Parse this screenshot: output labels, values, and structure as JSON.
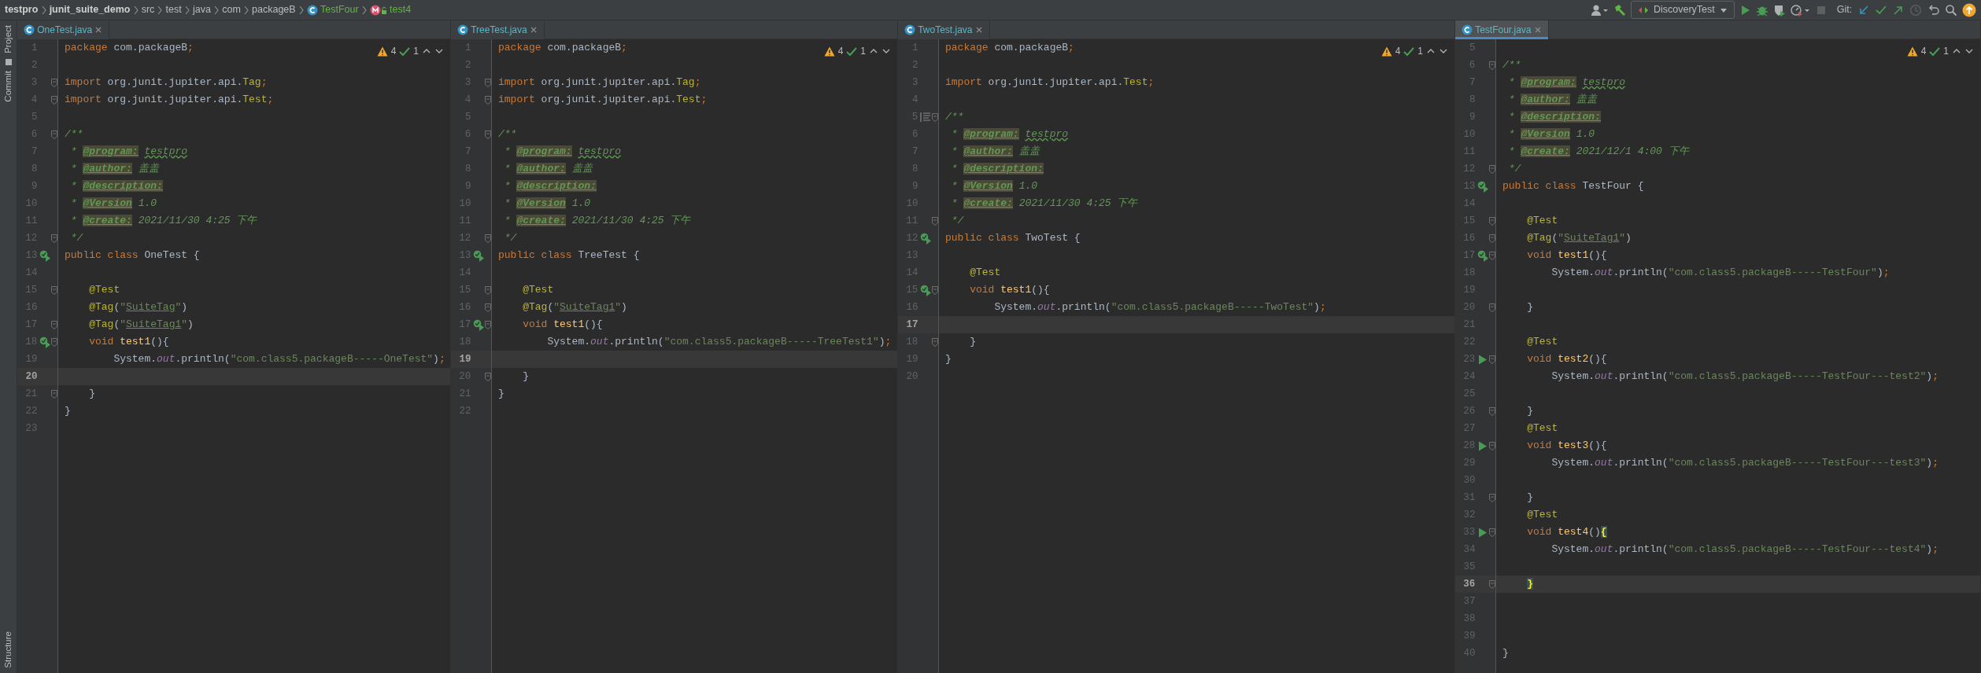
{
  "breadcrumb": [
    {
      "label": "testpro",
      "kind": "module"
    },
    {
      "label": "junit_suite_demo",
      "kind": "module"
    },
    {
      "label": "src",
      "kind": "dir"
    },
    {
      "label": "test",
      "kind": "dir"
    },
    {
      "label": "java",
      "kind": "dir"
    },
    {
      "label": "com",
      "kind": "dir"
    },
    {
      "label": "packageB",
      "kind": "dir"
    },
    {
      "label": "TestFour",
      "kind": "class"
    },
    {
      "label": "test4",
      "kind": "method"
    }
  ],
  "toolbar": {
    "run_config": "DiscoveryTest",
    "git_label": "Git:"
  },
  "tool_windows": [
    {
      "label": "Project"
    },
    {
      "label": "Commit"
    },
    {
      "label": "Structure"
    }
  ],
  "panes": [
    {
      "tab": {
        "label": "OneTest.java",
        "selected": false
      },
      "inspections": {
        "warnings": "4",
        "ok": "1"
      },
      "lines": [
        {
          "n": "1",
          "fold": false,
          "current": false,
          "tokens": [
            {
              "kind": "kw",
              "text": "package "
            },
            {
              "kind": "pl",
              "text": "com.packageB"
            },
            {
              "kind": "kw",
              "text": ";"
            }
          ]
        },
        {
          "n": "2",
          "fold": false,
          "current": false
        },
        {
          "n": "3",
          "fold": true,
          "current": false,
          "tokens": [
            {
              "kind": "kw",
              "text": "import "
            },
            {
              "kind": "pl",
              "text": "org.junit.jupiter.api."
            },
            {
              "kind": "cls",
              "text": "Tag"
            },
            {
              "kind": "kw",
              "text": ";"
            }
          ]
        },
        {
          "n": "4",
          "fold": true,
          "current": false,
          "tokens": [
            {
              "kind": "kw",
              "text": "import "
            },
            {
              "kind": "pl",
              "text": "org.junit.jupiter.api."
            },
            {
              "kind": "cls",
              "text": "Test"
            },
            {
              "kind": "kw",
              "text": ";"
            }
          ]
        },
        {
          "n": "5",
          "fold": false,
          "current": false
        },
        {
          "n": "6",
          "fold": true,
          "current": false,
          "tokens": [
            {
              "kind": "doc",
              "text": "/**"
            }
          ]
        },
        {
          "n": "7",
          "fold": false,
          "current": false,
          "tokens": [
            {
              "kind": "doc",
              "text": " * "
            },
            {
              "kind": "dtag",
              "text": "@program:"
            },
            {
              "kind": "dwave",
              "text": "testpro"
            }
          ]
        },
        {
          "n": "8",
          "fold": false,
          "current": false,
          "tokens": [
            {
              "kind": "doc",
              "text": " * "
            },
            {
              "kind": "dtag",
              "text": "@author:"
            },
            {
              "kind": "doc",
              "text": " 盖盖"
            }
          ]
        },
        {
          "n": "9",
          "fold": false,
          "current": false,
          "tokens": [
            {
              "kind": "doc",
              "text": " * "
            },
            {
              "kind": "dtag",
              "text": "@description:"
            }
          ]
        },
        {
          "n": "10",
          "fold": false,
          "current": false,
          "tokens": [
            {
              "kind": "doc",
              "text": " * "
            },
            {
              "kind": "dtag",
              "text": "@Version"
            },
            {
              "kind": "doc",
              "text": " 1.0"
            }
          ]
        },
        {
          "n": "11",
          "fold": false,
          "current": false,
          "tokens": [
            {
              "kind": "doc",
              "text": " * "
            },
            {
              "kind": "dtag",
              "text": "@create:"
            },
            {
              "kind": "doc",
              "text": " 2021/11/30 4:25 下午"
            }
          ]
        },
        {
          "n": "12",
          "fold": true,
          "current": false,
          "tokens": [
            {
              "kind": "doc",
              "text": " */"
            }
          ]
        },
        {
          "n": "13",
          "kind": "run-check",
          "fold": false,
          "current": false,
          "tokens": [
            {
              "kind": "kw",
              "text": "public class "
            },
            {
              "kind": "pl",
              "text": "OneTest {"
            }
          ]
        },
        {
          "n": "14",
          "fold": false,
          "current": false
        },
        {
          "n": "15",
          "fold": true,
          "current": false,
          "tokens": [
            {
              "kind": "ann",
              "text": "    @Test"
            }
          ]
        },
        {
          "n": "16",
          "fold": false,
          "current": false,
          "tokens": [
            {
              "kind": "ann",
              "text": "    @Tag"
            },
            {
              "kind": "pl",
              "text": "("
            },
            {
              "kind": "str",
              "text": "\""
            },
            {
              "kind": "sref",
              "text": "SuiteTag"
            },
            {
              "kind": "str",
              "text": "\""
            },
            {
              "kind": "pl",
              "text": ")"
            }
          ]
        },
        {
          "n": "17",
          "fold": true,
          "current": false,
          "tokens": [
            {
              "kind": "ann",
              "text": "    @Tag"
            },
            {
              "kind": "pl",
              "text": "("
            },
            {
              "kind": "str",
              "text": "\""
            },
            {
              "kind": "sref",
              "text": "SuiteTag1"
            },
            {
              "kind": "str",
              "text": "\""
            },
            {
              "kind": "pl",
              "text": ")"
            }
          ]
        },
        {
          "n": "18",
          "kind": "run-check",
          "fold": true,
          "current": false,
          "tokens": [
            {
              "kind": "kw",
              "text": "    void "
            },
            {
              "kind": "mth",
              "text": "test1"
            },
            {
              "kind": "pl",
              "text": "(){"
            }
          ]
        },
        {
          "n": "19",
          "fold": false,
          "current": false,
          "tokens": [
            {
              "kind": "pl",
              "text": "        System."
            },
            {
              "kind": "fld",
              "text": "out"
            },
            {
              "kind": "pl",
              "text": ".println("
            },
            {
              "kind": "str",
              "text": "\"com.class5.packageB-----OneTest\""
            },
            {
              "kind": "pl",
              "text": ")"
            },
            {
              "kind": "kw",
              "text": ";"
            }
          ]
        },
        {
          "n": "20",
          "fold": false,
          "current": true
        },
        {
          "n": "21",
          "fold": true,
          "current": false,
          "tokens": [
            {
              "kind": "pl",
              "text": "    }"
            }
          ]
        },
        {
          "n": "22",
          "fold": false,
          "current": false,
          "tokens": [
            {
              "kind": "pl",
              "text": "}"
            }
          ]
        },
        {
          "n": "23",
          "fold": false,
          "current": false
        }
      ]
    },
    {
      "tab": {
        "label": "TreeTest.java",
        "selected": false
      },
      "inspections": {
        "warnings": "4",
        "ok": "1"
      },
      "lines": [
        {
          "n": "1",
          "fold": false,
          "current": false,
          "tokens": [
            {
              "kind": "kw",
              "text": "package "
            },
            {
              "kind": "pl",
              "text": "com.packageB"
            },
            {
              "kind": "kw",
              "text": ";"
            }
          ]
        },
        {
          "n": "2",
          "fold": false,
          "current": false
        },
        {
          "n": "3",
          "fold": true,
          "current": false,
          "tokens": [
            {
              "kind": "kw",
              "text": "import "
            },
            {
              "kind": "pl",
              "text": "org.junit.jupiter.api."
            },
            {
              "kind": "cls",
              "text": "Tag"
            },
            {
              "kind": "kw",
              "text": ";"
            }
          ]
        },
        {
          "n": "4",
          "fold": true,
          "current": false,
          "tokens": [
            {
              "kind": "kw",
              "text": "import "
            },
            {
              "kind": "pl",
              "text": "org.junit.jupiter.api."
            },
            {
              "kind": "cls",
              "text": "Test"
            },
            {
              "kind": "kw",
              "text": ";"
            }
          ]
        },
        {
          "n": "5",
          "fold": false,
          "current": false
        },
        {
          "n": "6",
          "fold": true,
          "current": false,
          "tokens": [
            {
              "kind": "doc",
              "text": "/**"
            }
          ]
        },
        {
          "n": "7",
          "fold": false,
          "current": false,
          "tokens": [
            {
              "kind": "doc",
              "text": " * "
            },
            {
              "kind": "dtag",
              "text": "@program:"
            },
            {
              "kind": "dwave",
              "text": "testpro"
            }
          ]
        },
        {
          "n": "8",
          "fold": false,
          "current": false,
          "tokens": [
            {
              "kind": "doc",
              "text": " * "
            },
            {
              "kind": "dtag",
              "text": "@author:"
            },
            {
              "kind": "doc",
              "text": " 盖盖"
            }
          ]
        },
        {
          "n": "9",
          "fold": false,
          "current": false,
          "tokens": [
            {
              "kind": "doc",
              "text": " * "
            },
            {
              "kind": "dtag",
              "text": "@description:"
            }
          ]
        },
        {
          "n": "10",
          "fold": false,
          "current": false,
          "tokens": [
            {
              "kind": "doc",
              "text": " * "
            },
            {
              "kind": "dtag",
              "text": "@Version"
            },
            {
              "kind": "doc",
              "text": " 1.0"
            }
          ]
        },
        {
          "n": "11",
          "fold": false,
          "current": false,
          "tokens": [
            {
              "kind": "doc",
              "text": " * "
            },
            {
              "kind": "dtag",
              "text": "@create:"
            },
            {
              "kind": "doc",
              "text": " 2021/11/30 4:25 下午"
            }
          ]
        },
        {
          "n": "12",
          "fold": true,
          "current": false,
          "tokens": [
            {
              "kind": "doc",
              "text": " */"
            }
          ]
        },
        {
          "n": "13",
          "kind": "run-check",
          "fold": false,
          "current": false,
          "tokens": [
            {
              "kind": "kw",
              "text": "public class "
            },
            {
              "kind": "pl",
              "text": "TreeTest {"
            }
          ]
        },
        {
          "n": "14",
          "fold": false,
          "current": false
        },
        {
          "n": "15",
          "fold": true,
          "current": false,
          "tokens": [
            {
              "kind": "ann",
              "text": "    @Test"
            }
          ]
        },
        {
          "n": "16",
          "fold": true,
          "current": false,
          "tokens": [
            {
              "kind": "ann",
              "text": "    @Tag"
            },
            {
              "kind": "pl",
              "text": "("
            },
            {
              "kind": "str",
              "text": "\""
            },
            {
              "kind": "sref",
              "text": "SuiteTag1"
            },
            {
              "kind": "str",
              "text": "\""
            },
            {
              "kind": "pl",
              "text": ")"
            }
          ]
        },
        {
          "n": "17",
          "kind": "run-check",
          "fold": true,
          "current": false,
          "tokens": [
            {
              "kind": "kw",
              "text": "    void "
            },
            {
              "kind": "mth",
              "text": "test1"
            },
            {
              "kind": "pl",
              "text": "(){"
            }
          ]
        },
        {
          "n": "18",
          "fold": false,
          "current": false,
          "tokens": [
            {
              "kind": "pl",
              "text": "        System."
            },
            {
              "kind": "fld",
              "text": "out"
            },
            {
              "kind": "pl",
              "text": ".println("
            },
            {
              "kind": "str",
              "text": "\"com.class5.packageB-----TreeTest1\""
            },
            {
              "kind": "pl",
              "text": ")"
            },
            {
              "kind": "kw",
              "text": ";"
            }
          ]
        },
        {
          "n": "19",
          "fold": false,
          "current": true
        },
        {
          "n": "20",
          "fold": true,
          "current": false,
          "tokens": [
            {
              "kind": "pl",
              "text": "    }"
            }
          ]
        },
        {
          "n": "21",
          "fold": false,
          "current": false,
          "tokens": [
            {
              "kind": "pl",
              "text": "}"
            }
          ]
        },
        {
          "n": "22",
          "fold": false,
          "current": false
        }
      ]
    },
    {
      "tab": {
        "label": "TwoTest.java",
        "selected": false
      },
      "inspections": {
        "warnings": "4",
        "ok": "1"
      },
      "lines": [
        {
          "n": "1",
          "fold": false,
          "current": false,
          "tokens": [
            {
              "kind": "kw",
              "text": "package "
            },
            {
              "kind": "pl",
              "text": "com.packageB"
            },
            {
              "kind": "kw",
              "text": ";"
            }
          ]
        },
        {
          "n": "2",
          "fold": false,
          "current": false
        },
        {
          "n": "3",
          "fold": false,
          "current": false,
          "tokens": [
            {
              "kind": "kw",
              "text": "import "
            },
            {
              "kind": "pl",
              "text": "org.junit.jupiter.api."
            },
            {
              "kind": "cls",
              "text": "Test"
            },
            {
              "kind": "kw",
              "text": ";"
            }
          ]
        },
        {
          "n": "4",
          "fold": false,
          "current": false
        },
        {
          "n": "5",
          "kind": "doc",
          "fold": true,
          "current": false,
          "tokens": [
            {
              "kind": "doc",
              "text": "/**"
            }
          ]
        },
        {
          "n": "6",
          "fold": false,
          "current": false,
          "tokens": [
            {
              "kind": "doc",
              "text": " * "
            },
            {
              "kind": "dtag",
              "text": "@program:"
            },
            {
              "kind": "dwave",
              "text": "testpro"
            }
          ]
        },
        {
          "n": "7",
          "fold": false,
          "current": false,
          "tokens": [
            {
              "kind": "doc",
              "text": " * "
            },
            {
              "kind": "dtag",
              "text": "@author:"
            },
            {
              "kind": "doc",
              "text": " 盖盖"
            }
          ]
        },
        {
          "n": "8",
          "fold": false,
          "current": false,
          "tokens": [
            {
              "kind": "doc",
              "text": " * "
            },
            {
              "kind": "dtag",
              "text": "@description:"
            }
          ]
        },
        {
          "n": "9",
          "fold": false,
          "current": false,
          "tokens": [
            {
              "kind": "doc",
              "text": " * "
            },
            {
              "kind": "dtag",
              "text": "@Version"
            },
            {
              "kind": "doc",
              "text": " 1.0"
            }
          ]
        },
        {
          "n": "10",
          "fold": false,
          "current": false,
          "tokens": [
            {
              "kind": "doc",
              "text": " * "
            },
            {
              "kind": "dtag",
              "text": "@create:"
            },
            {
              "kind": "doc",
              "text": " 2021/11/30 4:25 下午"
            }
          ]
        },
        {
          "n": "11",
          "fold": true,
          "current": false,
          "tokens": [
            {
              "kind": "doc",
              "text": " */"
            }
          ]
        },
        {
          "n": "12",
          "kind": "run-check",
          "fold": false,
          "current": false,
          "tokens": [
            {
              "kind": "kw",
              "text": "public class "
            },
            {
              "kind": "pl",
              "text": "TwoTest {"
            }
          ]
        },
        {
          "n": "13",
          "fold": false,
          "current": false
        },
        {
          "n": "14",
          "fold": false,
          "current": false,
          "tokens": [
            {
              "kind": "ann",
              "text": "    @Test"
            }
          ]
        },
        {
          "n": "15",
          "kind": "run-check",
          "fold": true,
          "current": false,
          "tokens": [
            {
              "kind": "kw",
              "text": "    void "
            },
            {
              "kind": "mth",
              "text": "test1"
            },
            {
              "kind": "pl",
              "text": "(){"
            }
          ]
        },
        {
          "n": "16",
          "fold": false,
          "current": false,
          "tokens": [
            {
              "kind": "pl",
              "text": "        System."
            },
            {
              "kind": "fld",
              "text": "out"
            },
            {
              "kind": "pl",
              "text": ".println("
            },
            {
              "kind": "str",
              "text": "\"com.class5.packageB-----TwoTest\""
            },
            {
              "kind": "pl",
              "text": ")"
            },
            {
              "kind": "kw",
              "text": ";"
            }
          ]
        },
        {
          "n": "17",
          "fold": false,
          "current": true
        },
        {
          "n": "18",
          "fold": true,
          "current": false,
          "tokens": [
            {
              "kind": "pl",
              "text": "    }"
            }
          ]
        },
        {
          "n": "19",
          "fold": false,
          "current": false,
          "tokens": [
            {
              "kind": "pl",
              "text": "}"
            }
          ]
        },
        {
          "n": "20",
          "fold": false,
          "current": false
        }
      ]
    },
    {
      "tab": {
        "label": "TestFour.java",
        "selected": true
      },
      "inspections": {
        "warnings": "4",
        "ok": "1"
      },
      "lines": [
        {
          "n": "5",
          "fold": false,
          "current": false
        },
        {
          "n": "6",
          "fold": true,
          "current": false,
          "tokens": [
            {
              "kind": "doc",
              "text": "/**"
            }
          ]
        },
        {
          "n": "7",
          "fold": false,
          "current": false,
          "tokens": [
            {
              "kind": "doc",
              "text": " * "
            },
            {
              "kind": "dtag",
              "text": "@program:"
            },
            {
              "kind": "dwave",
              "text": "testpro"
            }
          ]
        },
        {
          "n": "8",
          "fold": false,
          "current": false,
          "tokens": [
            {
              "kind": "doc",
              "text": " * "
            },
            {
              "kind": "dtag",
              "text": "@author:"
            },
            {
              "kind": "doc",
              "text": " 盖盖"
            }
          ]
        },
        {
          "n": "9",
          "fold": false,
          "current": false,
          "tokens": [
            {
              "kind": "doc",
              "text": " * "
            },
            {
              "kind": "dtag",
              "text": "@description:"
            }
          ]
        },
        {
          "n": "10",
          "fold": false,
          "current": false,
          "tokens": [
            {
              "kind": "doc",
              "text": " * "
            },
            {
              "kind": "dtag",
              "text": "@Version"
            },
            {
              "kind": "doc",
              "text": " 1.0"
            }
          ]
        },
        {
          "n": "11",
          "fold": false,
          "current": false,
          "tokens": [
            {
              "kind": "doc",
              "text": " * "
            },
            {
              "kind": "dtag",
              "text": "@create:"
            },
            {
              "kind": "doc",
              "text": " 2021/12/1 4:00 下午"
            }
          ]
        },
        {
          "n": "12",
          "fold": true,
          "current": false,
          "tokens": [
            {
              "kind": "doc",
              "text": " */"
            }
          ]
        },
        {
          "n": "13",
          "kind": "run-check",
          "fold": false,
          "current": false,
          "tokens": [
            {
              "kind": "kw",
              "text": "public class "
            },
            {
              "kind": "pl",
              "text": "TestFour {"
            }
          ]
        },
        {
          "n": "14",
          "fold": false,
          "current": false
        },
        {
          "n": "15",
          "fold": true,
          "current": false,
          "tokens": [
            {
              "kind": "ann",
              "text": "    @Test"
            }
          ]
        },
        {
          "n": "16",
          "fold": true,
          "current": false,
          "tokens": [
            {
              "kind": "ann",
              "text": "    @Tag"
            },
            {
              "kind": "pl",
              "text": "("
            },
            {
              "kind": "str",
              "text": "\""
            },
            {
              "kind": "sref",
              "text": "SuiteTag1"
            },
            {
              "kind": "str",
              "text": "\""
            },
            {
              "kind": "pl",
              "text": ")"
            }
          ]
        },
        {
          "n": "17",
          "kind": "run-check",
          "fold": true,
          "current": false,
          "tokens": [
            {
              "kind": "kw",
              "text": "    void "
            },
            {
              "kind": "mth",
              "text": "test1"
            },
            {
              "kind": "pl",
              "text": "(){"
            }
          ]
        },
        {
          "n": "18",
          "fold": false,
          "current": false,
          "tokens": [
            {
              "kind": "pl",
              "text": "        System."
            },
            {
              "kind": "fld",
              "text": "out"
            },
            {
              "kind": "pl",
              "text": ".println("
            },
            {
              "kind": "str",
              "text": "\"com.class5.packageB-----TestFour\""
            },
            {
              "kind": "pl",
              "text": ")"
            },
            {
              "kind": "kw",
              "text": ";"
            }
          ]
        },
        {
          "n": "19",
          "fold": false,
          "current": false
        },
        {
          "n": "20",
          "fold": true,
          "current": false,
          "tokens": [
            {
              "kind": "pl",
              "text": "    }"
            }
          ]
        },
        {
          "n": "21",
          "fold": false,
          "current": false
        },
        {
          "n": "22",
          "fold": false,
          "current": false,
          "tokens": [
            {
              "kind": "ann",
              "text": "    @Test"
            }
          ]
        },
        {
          "n": "23",
          "kind": "run",
          "fold": true,
          "current": false,
          "tokens": [
            {
              "kind": "kw",
              "text": "    void "
            },
            {
              "kind": "mth",
              "text": "test2"
            },
            {
              "kind": "pl",
              "text": "(){"
            }
          ]
        },
        {
          "n": "24",
          "fold": false,
          "current": false,
          "tokens": [
            {
              "kind": "pl",
              "text": "        System."
            },
            {
              "kind": "fld",
              "text": "out"
            },
            {
              "kind": "pl",
              "text": ".println("
            },
            {
              "kind": "str",
              "text": "\"com.class5.packageB-----TestFour---test2\""
            },
            {
              "kind": "pl",
              "text": ")"
            },
            {
              "kind": "kw",
              "text": ";"
            }
          ]
        },
        {
          "n": "25",
          "fold": false,
          "current": false
        },
        {
          "n": "26",
          "fold": true,
          "current": false,
          "tokens": [
            {
              "kind": "pl",
              "text": "    }"
            }
          ]
        },
        {
          "n": "27",
          "fold": false,
          "current": false,
          "tokens": [
            {
              "kind": "ann",
              "text": "    @Test"
            }
          ]
        },
        {
          "n": "28",
          "kind": "run",
          "fold": true,
          "current": false,
          "tokens": [
            {
              "kind": "kw",
              "text": "    void "
            },
            {
              "kind": "mth",
              "text": "test3"
            },
            {
              "kind": "pl",
              "text": "(){"
            }
          ]
        },
        {
          "n": "29",
          "fold": false,
          "current": false,
          "tokens": [
            {
              "kind": "pl",
              "text": "        System."
            },
            {
              "kind": "fld",
              "text": "out"
            },
            {
              "kind": "pl",
              "text": ".println("
            },
            {
              "kind": "str",
              "text": "\"com.class5.packageB-----TestFour---test3\""
            },
            {
              "kind": "pl",
              "text": ")"
            },
            {
              "kind": "kw",
              "text": ";"
            }
          ]
        },
        {
          "n": "30",
          "fold": false,
          "current": false
        },
        {
          "n": "31",
          "fold": true,
          "current": false,
          "tokens": [
            {
              "kind": "pl",
              "text": "    }"
            }
          ]
        },
        {
          "n": "32",
          "fold": false,
          "current": false,
          "tokens": [
            {
              "kind": "ann",
              "text": "    @Test"
            }
          ]
        },
        {
          "n": "33",
          "kind": "run",
          "fold": true,
          "current": false,
          "tokens": [
            {
              "kind": "kw",
              "text": "    void "
            },
            {
              "kind": "mth",
              "text": "test4"
            },
            {
              "kind": "pl",
              "text": "()"
            },
            {
              "kind": "match",
              "text": "{"
            }
          ]
        },
        {
          "n": "34",
          "fold": false,
          "current": false,
          "tokens": [
            {
              "kind": "pl",
              "text": "        System."
            },
            {
              "kind": "fld",
              "text": "out"
            },
            {
              "kind": "pl",
              "text": ".println("
            },
            {
              "kind": "str",
              "text": "\"com.class5.packageB-----TestFour---test4\""
            },
            {
              "kind": "pl",
              "text": ")"
            },
            {
              "kind": "kw",
              "text": ";"
            }
          ]
        },
        {
          "n": "35",
          "fold": false,
          "current": false
        },
        {
          "n": "36",
          "fold": true,
          "current": true,
          "tokens": [
            {
              "kind": "match",
              "text": "    }"
            }
          ]
        },
        {
          "n": "37",
          "fold": false,
          "current": false
        },
        {
          "n": "38",
          "fold": false,
          "current": false
        },
        {
          "n": "39",
          "fold": false,
          "current": false
        },
        {
          "n": "40",
          "fold": false,
          "current": false,
          "tokens": [
            {
              "kind": "pl",
              "text": "}"
            }
          ]
        }
      ]
    }
  ]
}
